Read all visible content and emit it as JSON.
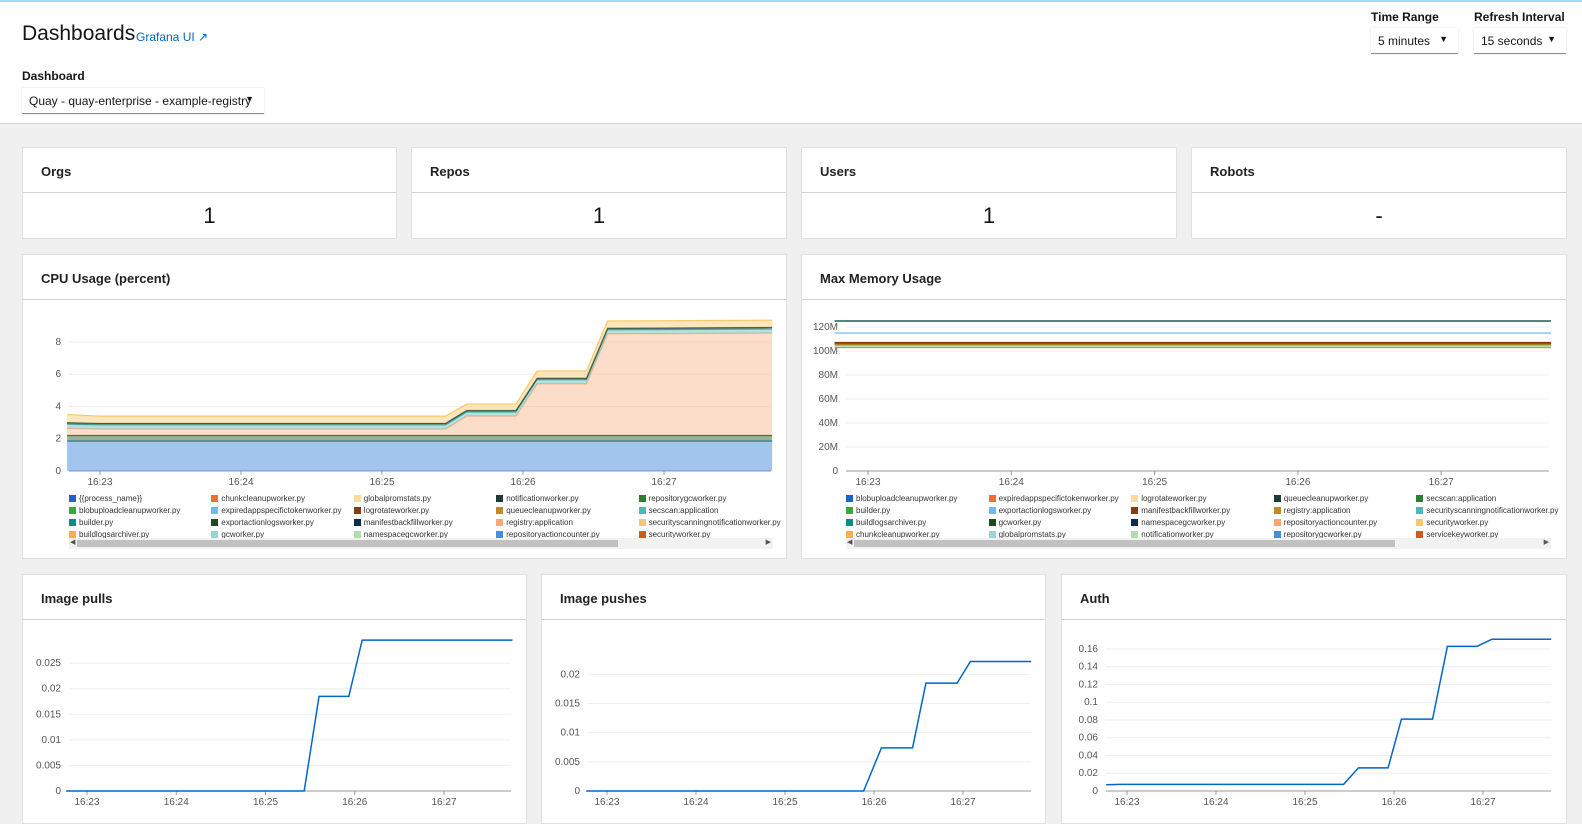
{
  "header": {
    "title": "Dashboards",
    "grafana_link": "Grafana UI ↗",
    "dashboard_label": "Dashboard",
    "dashboard_value": "Quay - quay-enterprise - example-registry",
    "time_range_label": "Time Range",
    "time_range_value": "5 minutes",
    "refresh_label": "Refresh Interval",
    "refresh_value": "15 seconds"
  },
  "stats": [
    {
      "title": "Orgs",
      "value": "1"
    },
    {
      "title": "Repos",
      "value": "1"
    },
    {
      "title": "Users",
      "value": "1"
    },
    {
      "title": "Robots",
      "value": "-"
    }
  ],
  "chart_data": [
    {
      "id": "cpu",
      "title": "CPU Usage (percent)",
      "type": "area",
      "stacked": true,
      "ylim": [
        0,
        9.3
      ],
      "yticks": [
        0,
        2,
        4,
        6,
        8
      ],
      "xticks": [
        "16:23",
        "16:24",
        "16:25",
        "16:26",
        "16:27"
      ],
      "x": [
        "16:22:46",
        "16:23:00",
        "16:25:27",
        "16:25:36",
        "16:25:57",
        "16:26:06",
        "16:26:27",
        "16:26:36",
        "16:27:46"
      ],
      "series": [
        {
          "name": "{{process_name}}",
          "color": "#2f7fd6",
          "values": [
            1.85,
            1.85,
            1.85,
            1.85,
            1.85,
            1.85,
            1.85,
            1.85,
            1.85
          ]
        },
        {
          "name": "exportactionlogsworker.py",
          "color": "#245a24",
          "values": [
            0.35,
            0.35,
            0.35,
            0.35,
            0.35,
            0.35,
            0.35,
            0.35,
            0.35
          ]
        },
        {
          "name": "registry:application",
          "color": "#f9b38a",
          "values": [
            0.45,
            0.4,
            0.4,
            1.2,
            1.2,
            3.2,
            3.2,
            6.3,
            6.35
          ]
        },
        {
          "name": "secscan:application",
          "color": "#5bbfb5",
          "values": [
            0.25,
            0.25,
            0.25,
            0.25,
            0.25,
            0.25,
            0.25,
            0.25,
            0.25
          ]
        },
        {
          "name": "notificationworker.py",
          "color": "#1e4040",
          "values": [
            0.1,
            0.1,
            0.1,
            0.1,
            0.1,
            0.1,
            0.1,
            0.1,
            0.1
          ]
        },
        {
          "name": "securityworker.py",
          "color": "#f8c96a",
          "values": [
            0.5,
            0.45,
            0.45,
            0.4,
            0.4,
            0.45,
            0.45,
            0.45,
            0.45
          ]
        }
      ],
      "legend": [
        [
          "{{process_name}}",
          "#1f63c6"
        ],
        [
          "chunkcleanupworker.py",
          "#ef7030"
        ],
        [
          "globalpromstats.py",
          "#fadb9a"
        ],
        [
          "notificationworker.py",
          "#1e3a36"
        ],
        [
          "repositorygcworker.py",
          "#2f7d32"
        ],
        [
          "blobuploadcleanupworker.py",
          "#3ca63c"
        ],
        [
          "expiredappspecifictokenworker.py",
          "#73b6f0"
        ],
        [
          "logrotateworker.py",
          "#8b3a12"
        ],
        [
          "queuecleanupworker.py",
          "#c8861e"
        ],
        [
          "secscan:application",
          "#4cb8b8"
        ],
        [
          "builder.py",
          "#0f8a85"
        ],
        [
          "exportactionlogsworker.py",
          "#1f4a1f"
        ],
        [
          "manifestbackfillworker.py",
          "#0d2b50"
        ],
        [
          "registry:application",
          "#f7a77a"
        ],
        [
          "securityscanningnotificationworker.py",
          "#f8c96a"
        ],
        [
          "buildlogsarchiver.py",
          "#f5b04a"
        ],
        [
          "gcworker.py",
          "#9ad6d0"
        ],
        [
          "namespacegcworker.py",
          "#b3dcb0"
        ],
        [
          "repositoryactioncounter.py",
          "#3d8fe0"
        ],
        [
          "securityworker.py",
          "#d05a1a"
        ]
      ]
    },
    {
      "id": "mem",
      "title": "Max Memory Usage",
      "type": "line",
      "ylim": [
        0,
        125
      ],
      "yticks": [
        "0",
        "20M",
        "40M",
        "60M",
        "80M",
        "100M",
        "120M"
      ],
      "ytick_values": [
        0,
        20,
        40,
        60,
        80,
        100,
        120
      ],
      "xticks": [
        "16:23",
        "16:24",
        "16:25",
        "16:26",
        "16:27"
      ],
      "x": [
        "16:22:46",
        "16:27:46"
      ],
      "series": [
        {
          "name": "queuecleanupworker.py",
          "color": "#1e5a50",
          "values": [
            125,
            125
          ]
        },
        {
          "name": "exportactionlogsworker.py",
          "color": "#8cc6f0",
          "values": [
            115,
            115
          ]
        },
        {
          "name": "manifestbackfillworker.py",
          "color": "#8b3a12",
          "values": [
            107,
            107
          ]
        },
        {
          "name": "secscan:application",
          "color": "#2f7d32",
          "values": [
            106,
            106
          ]
        },
        {
          "name": "registry:application",
          "color": "#c8861e",
          "values": [
            105,
            105
          ]
        },
        {
          "name": "builder.py",
          "color": "#7ab04a",
          "values": [
            103,
            103
          ]
        }
      ],
      "legend": [
        [
          "blobuploadcleanupworker.py",
          "#1f63c6"
        ],
        [
          "expiredappspecifictokenworker.py",
          "#ef7030"
        ],
        [
          "logrotateworker.py",
          "#fadb9a"
        ],
        [
          "queuecleanupworker.py",
          "#1e3a36"
        ],
        [
          "secscan:application",
          "#2f7d32"
        ],
        [
          "builder.py",
          "#3ca63c"
        ],
        [
          "exportactionlogsworker.py",
          "#73b6f0"
        ],
        [
          "manifestbackfillworker.py",
          "#8b3a12"
        ],
        [
          "registry:application",
          "#c8861e"
        ],
        [
          "securityscanningnotificationworker.py",
          "#4cb8b8"
        ],
        [
          "buildlogsarchiver.py",
          "#0f8a85"
        ],
        [
          "gcworker.py",
          "#1f4a1f"
        ],
        [
          "namespacegcworker.py",
          "#0d2b50"
        ],
        [
          "repositoryactioncounter.py",
          "#f7a77a"
        ],
        [
          "securityworker.py",
          "#f8c96a"
        ],
        [
          "chunkcleanupworker.py",
          "#f5b04a"
        ],
        [
          "globalpromstats.py",
          "#9ad6d0"
        ],
        [
          "notificationworker.py",
          "#b3dcb0"
        ],
        [
          "repositorygcworker.py",
          "#3d8fe0"
        ],
        [
          "servicekeyworker.py",
          "#d05a1a"
        ]
      ]
    },
    {
      "id": "pulls",
      "title": "Image pulls",
      "type": "line",
      "ylim": [
        0,
        0.0305
      ],
      "yticks": [
        "0",
        "0.005",
        "0.01",
        "0.015",
        "0.02",
        "0.025"
      ],
      "ytick_values": [
        0,
        0.005,
        0.01,
        0.015,
        0.02,
        0.025
      ],
      "xticks": [
        "16:23",
        "16:24",
        "16:25",
        "16:26",
        "16:27"
      ],
      "x": [
        "16:22:46",
        "16:25:26",
        "16:25:36",
        "16:25:56",
        "16:26:05",
        "16:27:46"
      ],
      "series": [
        {
          "color": "#0066cc",
          "values": [
            0,
            0,
            0.0185,
            0.0185,
            0.0295,
            0.0295
          ]
        }
      ]
    },
    {
      "id": "pushes",
      "title": "Image pushes",
      "type": "line",
      "ylim": [
        0,
        0.024
      ],
      "yticks": [
        "0",
        "0.005",
        "0.01",
        "0.015",
        "0.02"
      ],
      "ytick_values": [
        0,
        0.005,
        0.01,
        0.015,
        0.02
      ],
      "xticks": [
        "16:23",
        "16:24",
        "16:25",
        "16:26",
        "16:27"
      ],
      "x": [
        "16:22:46",
        "16:25:53",
        "16:26:05",
        "16:26:26",
        "16:26:35",
        "16:26:56",
        "16:27:05",
        "16:27:46"
      ],
      "series": [
        {
          "color": "#0066cc",
          "values": [
            0,
            0,
            0.0074,
            0.0074,
            0.0185,
            0.0185,
            0.0222,
            0.0222
          ]
        }
      ]
    },
    {
      "id": "auth",
      "title": "Auth",
      "type": "line",
      "ylim": [
        0,
        0.178
      ],
      "yticks": [
        "0",
        "0.02",
        "0.04",
        "0.06",
        "0.08",
        "0.1",
        "0.12",
        "0.14",
        "0.16"
      ],
      "ytick_values": [
        0,
        0.02,
        0.04,
        0.06,
        0.08,
        0.1,
        0.12,
        0.14,
        0.16
      ],
      "xticks": [
        "16:23",
        "16:24",
        "16:25",
        "16:26",
        "16:27"
      ],
      "x": [
        "16:22:46",
        "16:22:55",
        "16:25:26",
        "16:25:36",
        "16:25:56",
        "16:26:05",
        "16:26:26",
        "16:26:36",
        "16:26:56",
        "16:27:06",
        "16:27:46"
      ],
      "series": [
        {
          "color": "#0066cc",
          "values": [
            0.007,
            0.0075,
            0.0075,
            0.026,
            0.026,
            0.081,
            0.081,
            0.163,
            0.163,
            0.171,
            0.171
          ]
        }
      ]
    }
  ]
}
